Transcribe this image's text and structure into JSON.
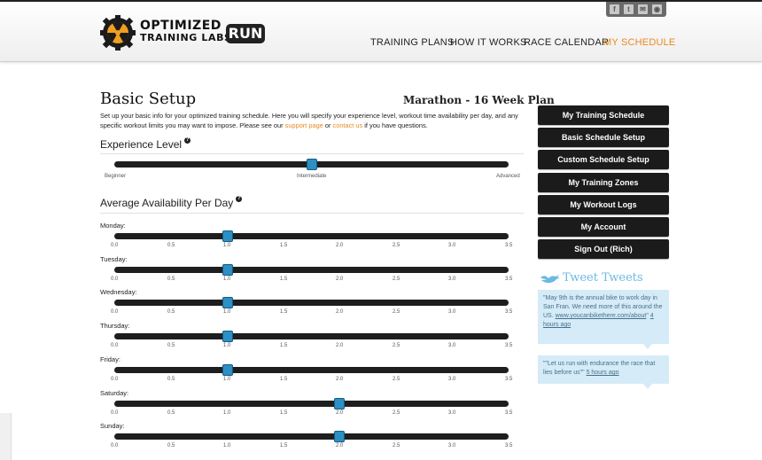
{
  "logo": {
    "line1": "OPTIMIZED",
    "line2": "TRAINING LABS",
    "run": "RUN"
  },
  "nav": [
    {
      "label": "TRAINING PLANS",
      "active": false
    },
    {
      "label": "HOW IT WORKS",
      "active": false
    },
    {
      "label": "RACE CALENDAR",
      "active": false
    },
    {
      "label": "MY SCHEDULE",
      "active": true
    }
  ],
  "social": [
    {
      "icon": "facebook-icon",
      "glyph": "f"
    },
    {
      "icon": "twitter-icon",
      "glyph": "t"
    },
    {
      "icon": "email-icon",
      "glyph": "✉"
    },
    {
      "icon": "rss-icon",
      "glyph": "◉"
    }
  ],
  "page": {
    "title": "Basic Setup",
    "plan": "Marathon - 16 Week Plan",
    "intro_1": "Set up your basic info for your optimized training schedule. Here you will specify your experience level, workout time availability per day, and any specific workout limits you may want to impose. Please see our ",
    "intro_link_1": "support page",
    "intro_2": " or ",
    "intro_link_2": "contact us",
    "intro_3": " if you have questions."
  },
  "experience": {
    "title": "Experience Level",
    "labels": [
      "Beginner",
      "Intermediate",
      "Advanced"
    ],
    "value": 0.5
  },
  "availability": {
    "title": "Average Availability Per Day",
    "ticks": [
      "0.0",
      "0.5",
      "1.0",
      "1.5",
      "2.0",
      "2.5",
      "3.0",
      "3.5"
    ],
    "days": [
      {
        "label": "Monday:",
        "value": 1.0
      },
      {
        "label": "Tuesday:",
        "value": 1.0
      },
      {
        "label": "Wednesday:",
        "value": 1.0
      },
      {
        "label": "Thursday:",
        "value": 1.0
      },
      {
        "label": "Friday:",
        "value": 1.0
      },
      {
        "label": "Saturday:",
        "value": 2.0
      },
      {
        "label": "Sunday:",
        "value": 2.0
      }
    ]
  },
  "sidebar": {
    "buttons": [
      "My Training Schedule",
      "Basic Schedule Setup",
      "Custom Schedule Setup",
      "My Training Zones",
      "My Workout Logs",
      "My Account",
      "Sign Out (Rich)"
    ]
  },
  "tweets": {
    "title": "Tweet Tweets",
    "items": [
      {
        "text": "\"May 9th is the annual bike to work day in San Fran. We need more of this around the US. ",
        "link": "www.youcanbikethere.com/about",
        "suffix": "\" ",
        "time": "4 hours ago"
      },
      {
        "text": "\"\"Let us run with endurance the race that lies before us\"\" ",
        "link": "",
        "suffix": "",
        "time": "5 hours ago"
      }
    ]
  },
  "colors": {
    "accent": "#e8891f",
    "thumb": "#2d8fc4",
    "button": "#1b1b1b",
    "tweet_bg": "#d5ebf7"
  }
}
